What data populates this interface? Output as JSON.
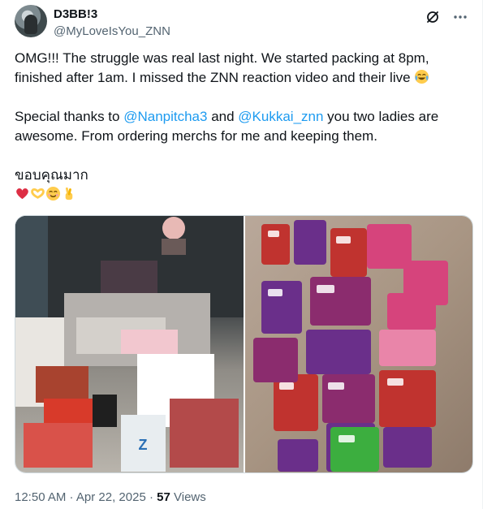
{
  "author": {
    "display_name": "D3BB!3",
    "handle": "@MyLoveIsYou_ZNN"
  },
  "header_icons": [
    "grok-icon",
    "more-icon"
  ],
  "tweet": {
    "line1": "OMG!!! The struggle was real last night. We started packing at 8pm,",
    "line2": "finished after 1am. I missed the ZNN reaction video and their live",
    "thanks_prefix": "Special thanks to ",
    "mention1": "@Nanpitcha3",
    "thanks_mid": " and ",
    "mention2": "@Kukkai_znn",
    "thanks_suffix": " you two ladies are",
    "line4": "awesome. From ordering merchs for me and keeping them.",
    "thai": "ขอบคุณมาก",
    "emojis": [
      "red-heart",
      "heart-hands",
      "smiling-face",
      "crossed-fingers"
    ]
  },
  "meta": {
    "time": "12:50 AM",
    "separator": " · ",
    "date": "Apr 22, 2025",
    "views_count": "57",
    "views_label": " Views"
  }
}
